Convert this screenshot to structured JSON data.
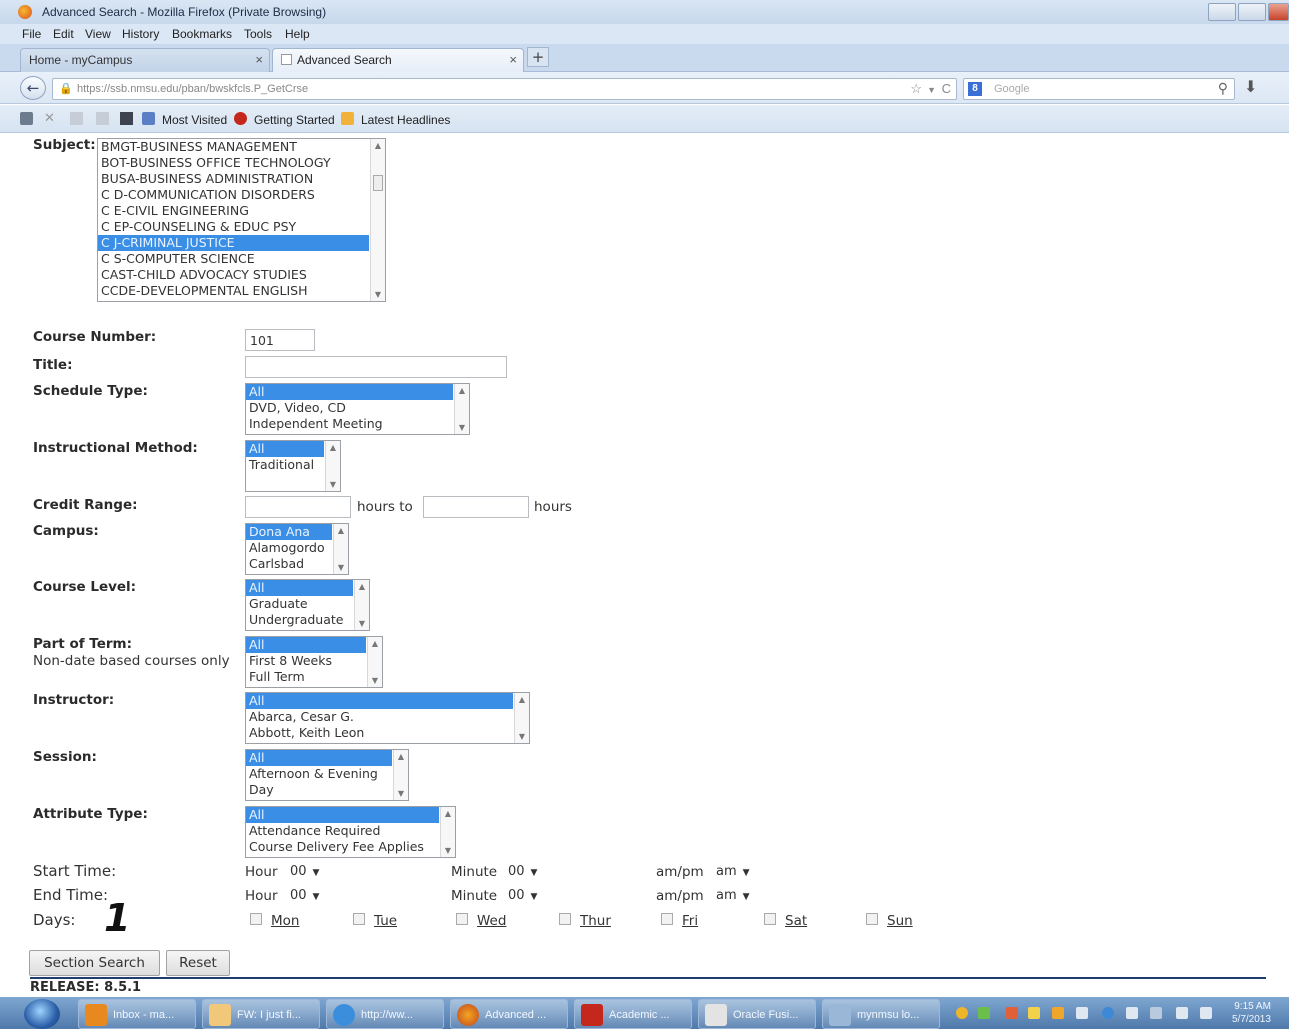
{
  "window": {
    "title": "Advanced Search - Mozilla Firefox (Private Browsing)",
    "menu": [
      "File",
      "Edit",
      "View",
      "History",
      "Bookmarks",
      "Tools",
      "Help"
    ],
    "tabs": [
      {
        "label": "Home - myCampus"
      },
      {
        "label": "Advanced Search"
      }
    ],
    "url": "https://ssb.nmsu.edu/pban/bwskfcls.P_GetCrse",
    "search_placeholder": "Google",
    "bookmarks": [
      "Most Visited",
      "Getting Started",
      "Latest Headlines"
    ]
  },
  "form": {
    "subject": {
      "label": "Subject:",
      "options": [
        "BMGT-BUSINESS MANAGEMENT",
        "BOT-BUSINESS OFFICE TECHNOLOGY",
        "BUSA-BUSINESS ADMINISTRATION",
        "C D-COMMUNICATION DISORDERS",
        "C E-CIVIL ENGINEERING",
        "C EP-COUNSELING & EDUC PSY",
        "C J-CRIMINAL JUSTICE",
        "C S-COMPUTER SCIENCE",
        "CAST-CHILD ADVOCACY STUDIES",
        "CCDE-DEVELOPMENTAL ENGLISH"
      ],
      "selected": "C J-CRIMINAL JUSTICE"
    },
    "course_number": {
      "label": "Course Number:",
      "value": "101"
    },
    "title": {
      "label": "Title:",
      "value": ""
    },
    "schedule_type": {
      "label": "Schedule Type:",
      "options": [
        "All",
        "DVD, Video, CD",
        "Independent Meeting"
      ],
      "selected": "All"
    },
    "instructional_method": {
      "label": "Instructional Method:",
      "options": [
        "All",
        "Traditional"
      ],
      "selected": "All"
    },
    "credit_range": {
      "label": "Credit Range:",
      "from": "",
      "to": "",
      "mid_text": "hours to",
      "end_text": "hours"
    },
    "campus": {
      "label": "Campus:",
      "options": [
        "Dona Ana",
        "Alamogordo",
        "Carlsbad"
      ],
      "selected": "Dona Ana"
    },
    "course_level": {
      "label": "Course Level:",
      "options": [
        "All",
        "Graduate",
        "Undergraduate"
      ],
      "selected": "All"
    },
    "part_of_term": {
      "label": "Part of Term:",
      "note": "Non-date based courses only",
      "options": [
        "All",
        "First 8 Weeks",
        "Full Term"
      ],
      "selected": "All"
    },
    "instructor": {
      "label": "Instructor:",
      "options": [
        "All",
        "Abarca, Cesar G.",
        "Abbott, Keith Leon"
      ],
      "selected": "All"
    },
    "session": {
      "label": "Session:",
      "options": [
        "All",
        "Afternoon & Evening",
        "Day"
      ],
      "selected": "All"
    },
    "attribute_type": {
      "label": "Attribute Type:",
      "options": [
        "All",
        "Attendance Required",
        "Course Delivery Fee Applies"
      ],
      "selected": "All"
    },
    "start_time": {
      "label": "Start Time:",
      "hour_label": "Hour",
      "hour": "00",
      "minute_label": "Minute",
      "minute": "00",
      "ampm_label": "am/pm",
      "ampm": "am"
    },
    "end_time": {
      "label": "End Time:",
      "hour_label": "Hour",
      "hour": "00",
      "minute_label": "Minute",
      "minute": "00",
      "ampm_label": "am/pm",
      "ampm": "am"
    },
    "days": {
      "label": "Days:",
      "annotation": "1",
      "items": [
        "Mon",
        "Tue",
        "Wed",
        "Thur",
        "Fri",
        "Sat",
        "Sun"
      ]
    },
    "buttons": {
      "search": "Section Search",
      "reset": "Reset"
    },
    "release": "RELEASE: 8.5.1"
  },
  "taskbar": {
    "items": [
      "Inbox - ma...",
      "FW: I just fi...",
      "http://ww...",
      "Advanced ...",
      "Academic ...",
      "Oracle Fusi...",
      "mynmsu lo..."
    ],
    "time": "9:15 AM",
    "date": "5/7/2013"
  }
}
